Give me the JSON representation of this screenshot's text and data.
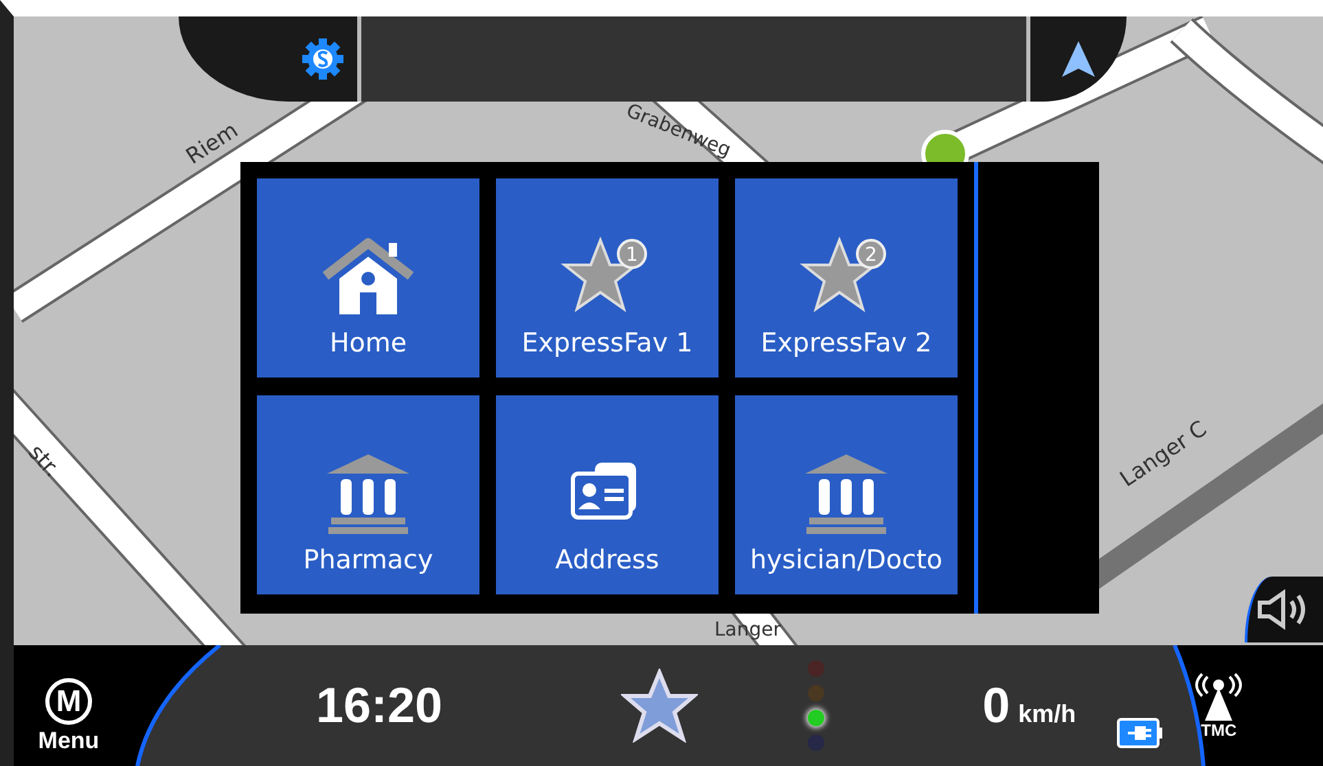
{
  "map": {
    "street_labels": [
      "Grabenweg",
      "Riem",
      "str.",
      "Langer",
      "Langer C"
    ]
  },
  "menu": {
    "items": [
      {
        "label": "Home",
        "kind": "home"
      },
      {
        "label": "ExpressFav 1",
        "kind": "favorite",
        "badge": "1"
      },
      {
        "label": "ExpressFav 2",
        "kind": "favorite",
        "badge": "2"
      },
      {
        "label": "Pharmacy",
        "kind": "poi"
      },
      {
        "label": "Address",
        "kind": "contact"
      },
      {
        "label": "hysician/Docto",
        "kind": "poi"
      }
    ]
  },
  "bottom_bar": {
    "menu_letter": "M",
    "menu_label": "Menu",
    "time": "16:20",
    "speed": "0",
    "speed_unit": "km/h",
    "tmc_label": "TMC",
    "traffic_lights": [
      {
        "color": "#4a2424",
        "on": false
      },
      {
        "color": "#4a3820",
        "on": false
      },
      {
        "color": "#22cc22",
        "on": true
      },
      {
        "color": "#262848",
        "on": false
      }
    ]
  }
}
